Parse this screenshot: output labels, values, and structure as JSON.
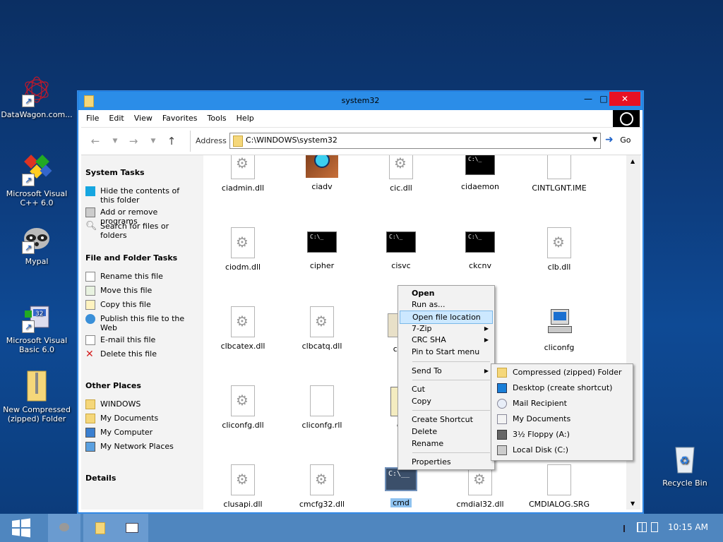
{
  "desktop": {
    "icons": [
      {
        "label": "DataWagon.com...",
        "icon": "datawagon-icon"
      },
      {
        "label": "Microsoft Visual C++ 6.0",
        "icon": "visual-cpp-icon"
      },
      {
        "label": "Mypal",
        "icon": "raccoon-icon"
      },
      {
        "label": "Microsoft Visual Basic 6.0",
        "icon": "visual-basic-icon"
      },
      {
        "label": "New Compressed (zipped) Folder",
        "icon": "zip-folder-icon"
      }
    ],
    "recycle_bin": "Recycle Bin"
  },
  "window": {
    "title": "system32",
    "menu": [
      "File",
      "Edit",
      "View",
      "Favorites",
      "Tools",
      "Help"
    ],
    "address_label": "Address",
    "address_value": "C:\\WINDOWS\\system32",
    "go_label": "Go"
  },
  "left_pane": {
    "system_tasks_title": "System Tasks",
    "system_tasks": [
      "Hide the contents of this folder",
      "Add or remove programs",
      "Search for files or folders"
    ],
    "file_tasks_title": "File and Folder Tasks",
    "file_tasks": [
      "Rename this file",
      "Move this file",
      "Copy this file",
      "Publish this file to the Web",
      "E-mail this file",
      "Delete this file"
    ],
    "other_places_title": "Other Places",
    "other_places": [
      "WINDOWS",
      "My Documents",
      "My Computer",
      "My Network Places"
    ],
    "details_title": "Details"
  },
  "files": [
    {
      "name": "ciadmin.dll",
      "kind": "dll"
    },
    {
      "name": "ciadv",
      "kind": "app"
    },
    {
      "name": "cic.dll",
      "kind": "dll"
    },
    {
      "name": "cidaemon",
      "kind": "console"
    },
    {
      "name": "CINTLGNT.IME",
      "kind": "blank"
    },
    {
      "name": "ciodm.dll",
      "kind": "dll"
    },
    {
      "name": "cipher",
      "kind": "console"
    },
    {
      "name": "cisvc",
      "kind": "console"
    },
    {
      "name": "ckcnv",
      "kind": "console"
    },
    {
      "name": "clb.dll",
      "kind": "dll"
    },
    {
      "name": "clbcatex.dll",
      "kind": "dll"
    },
    {
      "name": "clbcatq.dll",
      "kind": "dll"
    },
    {
      "name": "clea",
      "kind": "app"
    },
    {
      "name": "",
      "kind": "hidden"
    },
    {
      "name": "cliconfg",
      "kind": "computer"
    },
    {
      "name": "cliconfg.dll",
      "kind": "dll"
    },
    {
      "name": "cliconfg.rll",
      "kind": "blank"
    },
    {
      "name": "cli",
      "kind": "app"
    },
    {
      "name": "",
      "kind": "hidden"
    },
    {
      "name": "",
      "kind": "hidden"
    },
    {
      "name": "clusapi.dll",
      "kind": "dll"
    },
    {
      "name": "cmcfg32.dll",
      "kind": "dll"
    },
    {
      "name": "cmd",
      "kind": "console"
    },
    {
      "name": "cmdial32.dll",
      "kind": "dll"
    },
    {
      "name": "CMDIALOG.SRG",
      "kind": "blank"
    }
  ],
  "context_menu": {
    "items": [
      "Open",
      "Run as...",
      "Open file location",
      "7-Zip",
      "CRC SHA",
      "Pin to Start menu",
      "Send To",
      "Cut",
      "Copy",
      "Create Shortcut",
      "Delete",
      "Rename",
      "Properties"
    ]
  },
  "send_to_menu": {
    "items": [
      "Compressed (zipped) Folder",
      "Desktop (create shortcut)",
      "Mail Recipient",
      "My Documents",
      "3½ Floppy (A:)",
      "Local Disk (C:)"
    ]
  },
  "taskbar": {
    "time": "10:15 AM"
  },
  "colors": {
    "titlebar": "#2b8de8",
    "taskbar": "#4f86bf",
    "close_button": "#e81123",
    "highlight": "#cce8ff"
  }
}
